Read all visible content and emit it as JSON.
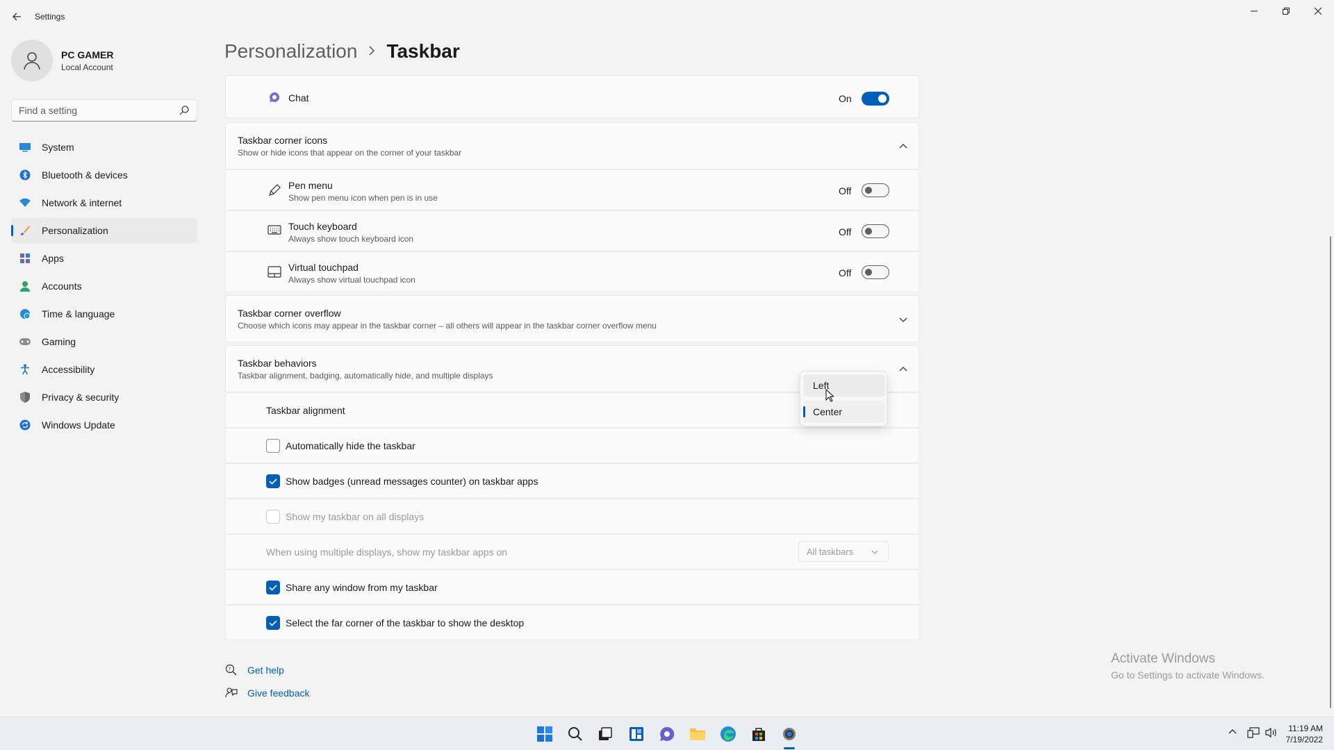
{
  "window": {
    "title": "Settings"
  },
  "profile": {
    "name": "PC GAMER",
    "account_type": "Local Account"
  },
  "search": {
    "placeholder": "Find a setting"
  },
  "nav": {
    "items": [
      {
        "label": "System",
        "icon": "system-icon",
        "active": false
      },
      {
        "label": "Bluetooth & devices",
        "icon": "bluetooth-icon",
        "active": false
      },
      {
        "label": "Network & internet",
        "icon": "wifi-icon",
        "active": false
      },
      {
        "label": "Personalization",
        "icon": "brush-icon",
        "active": true
      },
      {
        "label": "Apps",
        "icon": "apps-icon",
        "active": false
      },
      {
        "label": "Accounts",
        "icon": "person-icon",
        "active": false
      },
      {
        "label": "Time & language",
        "icon": "globe-clock-icon",
        "active": false
      },
      {
        "label": "Gaming",
        "icon": "gamepad-icon",
        "active": false
      },
      {
        "label": "Accessibility",
        "icon": "accessibility-icon",
        "active": false
      },
      {
        "label": "Privacy & security",
        "icon": "shield-icon",
        "active": false
      },
      {
        "label": "Windows Update",
        "icon": "update-icon",
        "active": false
      }
    ]
  },
  "breadcrumb": {
    "parent": "Personalization",
    "current": "Taskbar"
  },
  "chat": {
    "label": "Chat",
    "state": "On",
    "on": true
  },
  "corner_icons": {
    "title": "Taskbar corner icons",
    "subtitle": "Show or hide icons that appear on the corner of your taskbar",
    "items": [
      {
        "label": "Pen menu",
        "sub": "Show pen menu icon when pen is in use",
        "state": "Off"
      },
      {
        "label": "Touch keyboard",
        "sub": "Always show touch keyboard icon",
        "state": "Off"
      },
      {
        "label": "Virtual touchpad",
        "sub": "Always show virtual touchpad icon",
        "state": "Off"
      }
    ]
  },
  "corner_overflow": {
    "title": "Taskbar corner overflow",
    "subtitle": "Choose which icons may appear in the taskbar corner – all others will appear in the taskbar corner overflow menu"
  },
  "behaviors": {
    "title": "Taskbar behaviors",
    "subtitle": "Taskbar alignment, badging, automatically hide, and multiple displays",
    "alignment_label": "Taskbar alignment",
    "alignment_options": [
      "Left",
      "Center"
    ],
    "alignment_selected": "Center",
    "auto_hide": "Automatically hide the taskbar",
    "badges": "Show badges (unread messages counter) on taskbar apps",
    "all_displays": "Show my taskbar on all displays",
    "multi_display_label": "When using multiple displays, show my taskbar apps on",
    "multi_display_value": "All taskbars",
    "share_window": "Share any window from my taskbar",
    "far_corner": "Select the far corner of the taskbar to show the desktop"
  },
  "help": {
    "get_help": "Get help",
    "give_feedback": "Give feedback"
  },
  "watermark": {
    "title": "Activate Windows",
    "subtitle": "Go to Settings to activate Windows."
  },
  "clock": {
    "time": "11:19 AM",
    "date": "7/19/2022"
  },
  "colors": {
    "accent": "#005fb8",
    "background": "#f3f3f3",
    "card": "#fbfbfb"
  }
}
